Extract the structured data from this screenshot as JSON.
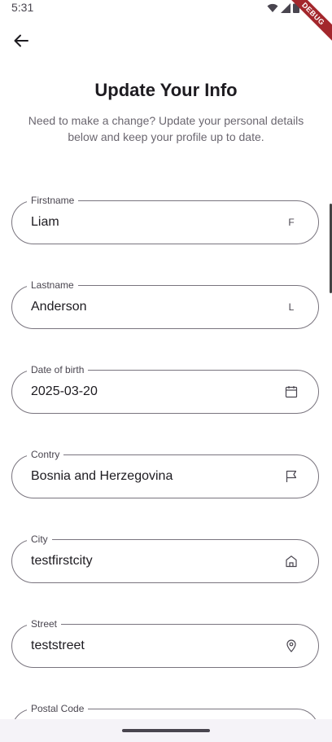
{
  "status_bar": {
    "time": "5:31",
    "debug_label": "DEBUG"
  },
  "header": {
    "title": "Update Your Info",
    "subtitle": "Need to make a change? Update your personal details below and keep your profile up to date."
  },
  "fields": {
    "firstname": {
      "label": "Firstname",
      "value": "Liam",
      "icon_glyph": "F",
      "icon": "letter-f-icon"
    },
    "lastname": {
      "label": "Lastname",
      "value": "Anderson",
      "icon_glyph": "L",
      "icon": "letter-l-icon"
    },
    "dob": {
      "label": "Date of birth",
      "value": "2025-03-20",
      "icon": "calendar-icon"
    },
    "country": {
      "label": "Contry",
      "value": "Bosnia and Herzegovina",
      "icon": "flag-icon"
    },
    "city": {
      "label": "City",
      "value": "testfirstcity",
      "icon": "home-icon"
    },
    "street": {
      "label": "Street",
      "value": "teststreet",
      "icon": "location-pin-icon"
    },
    "postal_code": {
      "label": "Postal Code",
      "value": ""
    }
  },
  "colors": {
    "border": "#79747e",
    "text": "#1d1b20",
    "label": "#49454f",
    "debug_ribbon": "#a3272c"
  }
}
